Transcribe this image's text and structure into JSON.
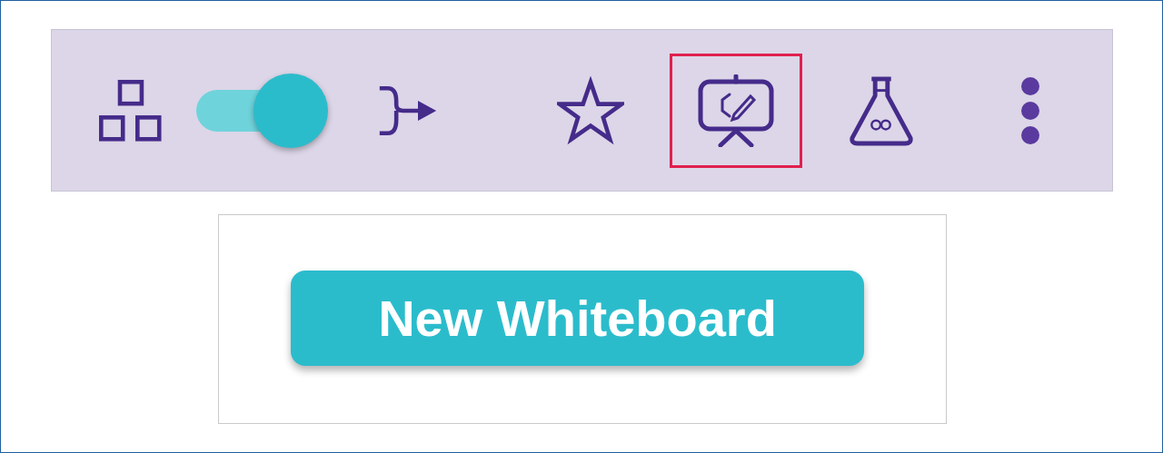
{
  "toolbar": {
    "items": [
      {
        "kind": "tree",
        "selected": false
      },
      {
        "kind": "toggle",
        "on": true
      },
      {
        "kind": "merge",
        "selected": false
      },
      {
        "kind": "star",
        "selected": false
      },
      {
        "kind": "whiteboard",
        "selected": true
      },
      {
        "kind": "flask",
        "selected": false
      },
      {
        "kind": "more",
        "selected": false
      }
    ]
  },
  "panel": {
    "button": {
      "label": "New Whiteboard"
    }
  }
}
